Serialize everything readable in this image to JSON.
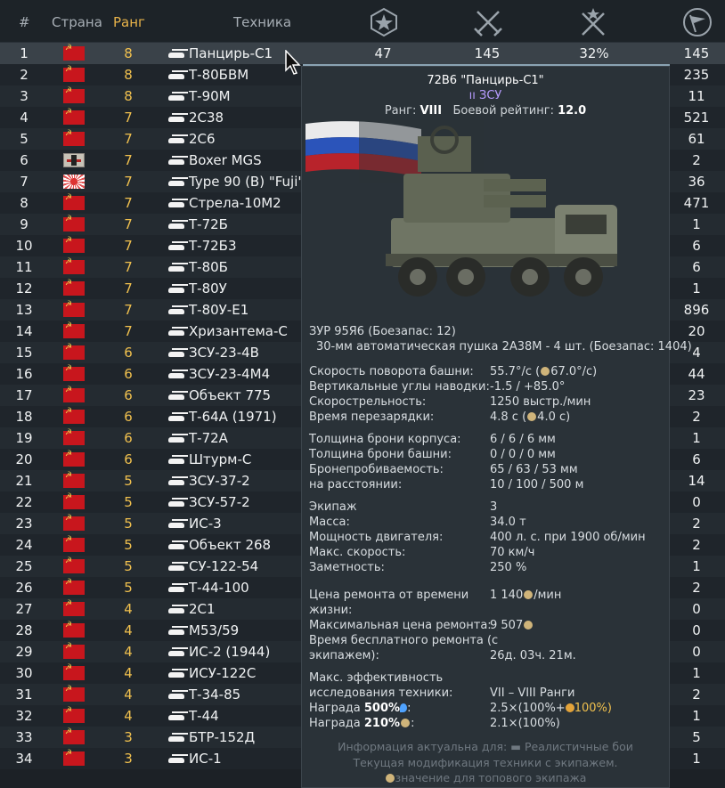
{
  "header": {
    "num": "#",
    "country": "Страна",
    "rank": "Ранг",
    "vehicle": "Техника",
    "icons": [
      "battles-icon",
      "kills-icon",
      "winrate-icon",
      "flag-icon"
    ]
  },
  "rows": [
    {
      "num": "1",
      "flag": "ussr",
      "rank": "8",
      "name": "Панцирь-С1",
      "v1": "47",
      "v2": "145",
      "v3": "32%",
      "v4": "145"
    },
    {
      "num": "2",
      "flag": "ussr",
      "rank": "8",
      "name": "Т-80БВМ",
      "v4": "235"
    },
    {
      "num": "3",
      "flag": "ussr",
      "rank": "8",
      "name": "Т-90М",
      "v4": "11"
    },
    {
      "num": "4",
      "flag": "ussr",
      "rank": "7",
      "name": "2С38",
      "v4": "521"
    },
    {
      "num": "5",
      "flag": "ussr",
      "rank": "7",
      "name": "2С6",
      "v4": "61"
    },
    {
      "num": "6",
      "flag": "de",
      "rank": "7",
      "name": "Boxer MGS",
      "v4": "2"
    },
    {
      "num": "7",
      "flag": "jp",
      "rank": "7",
      "name": "Type 90 (B) \"Fuji\"",
      "v4": "36"
    },
    {
      "num": "8",
      "flag": "ussr",
      "rank": "7",
      "name": "Стрела-10М2",
      "v4": "471"
    },
    {
      "num": "9",
      "flag": "ussr",
      "rank": "7",
      "name": "Т-72Б",
      "v4": "1"
    },
    {
      "num": "10",
      "flag": "ussr",
      "rank": "7",
      "name": "Т-72Б3",
      "v4": "6"
    },
    {
      "num": "11",
      "flag": "ussr",
      "rank": "7",
      "name": "Т-80Б",
      "v4": "6"
    },
    {
      "num": "12",
      "flag": "ussr",
      "rank": "7",
      "name": "Т-80У",
      "v4": "1"
    },
    {
      "num": "13",
      "flag": "ussr",
      "rank": "7",
      "name": "Т-80У-Е1",
      "v4": "896"
    },
    {
      "num": "14",
      "flag": "ussr",
      "rank": "7",
      "name": "Хризантема-С",
      "v4": "20"
    },
    {
      "num": "15",
      "flag": "ussr",
      "rank": "6",
      "name": "ЗСУ-23-4В",
      "v4": "4"
    },
    {
      "num": "16",
      "flag": "ussr",
      "rank": "6",
      "name": "ЗСУ-23-4М4",
      "v4": "44"
    },
    {
      "num": "17",
      "flag": "ussr",
      "rank": "6",
      "name": "Объект 775",
      "v4": "23"
    },
    {
      "num": "18",
      "flag": "ussr",
      "rank": "6",
      "name": "Т-64А (1971)",
      "v4": "2"
    },
    {
      "num": "19",
      "flag": "ussr",
      "rank": "6",
      "name": "Т-72А",
      "v4": "1"
    },
    {
      "num": "20",
      "flag": "ussr",
      "rank": "6",
      "name": "Штурм-С",
      "v4": "6"
    },
    {
      "num": "21",
      "flag": "ussr",
      "rank": "5",
      "name": "ЗСУ-37-2",
      "v4": "14"
    },
    {
      "num": "22",
      "flag": "ussr",
      "rank": "5",
      "name": "ЗСУ-57-2",
      "v4": "0"
    },
    {
      "num": "23",
      "flag": "ussr",
      "rank": "5",
      "name": "ИС-3",
      "v4": "2"
    },
    {
      "num": "24",
      "flag": "ussr",
      "rank": "5",
      "name": "Объект 268",
      "v4": "2"
    },
    {
      "num": "25",
      "flag": "ussr",
      "rank": "5",
      "name": "СУ-122-54",
      "v4": "1"
    },
    {
      "num": "26",
      "flag": "ussr",
      "rank": "5",
      "name": "Т-44-100",
      "v4": "2"
    },
    {
      "num": "27",
      "flag": "ussr",
      "rank": "4",
      "name": "2С1",
      "v4": "0"
    },
    {
      "num": "28",
      "flag": "ussr",
      "rank": "4",
      "name": "M53/59",
      "v4": "0"
    },
    {
      "num": "29",
      "flag": "ussr",
      "rank": "4",
      "name": "ИС-2 (1944)",
      "v4": "0"
    },
    {
      "num": "30",
      "flag": "ussr",
      "rank": "4",
      "name": "ИСУ-122С",
      "v4": "1"
    },
    {
      "num": "31",
      "flag": "ussr",
      "rank": "4",
      "name": "Т-34-85",
      "v4": "2"
    },
    {
      "num": "32",
      "flag": "ussr",
      "rank": "4",
      "name": "Т-44",
      "v4": "1"
    },
    {
      "num": "33",
      "flag": "ussr",
      "rank": "3",
      "name": "БТР-152Д",
      "v4": "5"
    },
    {
      "num": "34",
      "flag": "ussr",
      "rank": "3",
      "name": "ИС-1",
      "v4": "1"
    }
  ],
  "tooltip": {
    "title": "72В6 \"Панцирь-С1\"",
    "class": "ЗСУ",
    "rank_label": "Ранг:",
    "rank_value": "VIII",
    "br_label": "Боевой рейтинг:",
    "br_value": "12.0",
    "weapons": [
      "ЗУР 95Я6 (Боезапас: 12)",
      "30-мм автоматическая пушка 2А38М - 4 шт. (Боезапас: 1404)"
    ],
    "stats": [
      {
        "label": "Скорость поворота башни:",
        "value": "55.7°/с (",
        "extra": "67.0°/с)"
      },
      {
        "label": "Вертикальные углы наводки:",
        "value": "-1.5 / +85.0°"
      },
      {
        "label": "Скорострельность:",
        "value": "1250 выстр./мин"
      },
      {
        "label": "Время перезарядки:",
        "value": "4.8 с (",
        "extra": "4.0 с)"
      },
      {
        "label": "Толщина брони корпуса:",
        "value": "6 / 6 / 6 мм"
      },
      {
        "label": "Толщина брони башни:",
        "value": "0 / 0 / 0 мм"
      },
      {
        "label": "Бронепробиваемость:",
        "value": "65 / 63 / 53 мм"
      },
      {
        "label": "на расстоянии:",
        "value": "10 / 100 / 500 м"
      },
      {
        "label": "Экипаж",
        "value": "3"
      },
      {
        "label": "Масса:",
        "value": "34.0 т"
      },
      {
        "label": "Мощность двигателя:",
        "value": "400 л. с. при 1900 об/мин"
      },
      {
        "label": "Макс. скорость:",
        "value": "70 км/ч"
      },
      {
        "label": "Заметность:",
        "value": "250 %"
      }
    ],
    "repair": {
      "time_cost_label_1": "Цена ремонта от времени",
      "time_cost_label_2": "жизни:",
      "time_cost_value": "1 140",
      "time_cost_unit": "/мин",
      "max_cost_label": "Максимальная цена ремонта:",
      "max_cost_value": "9 507",
      "free_label_1": "Время бесплатного ремонта (с",
      "free_label_2": "экипажем):",
      "free_value": "26д. 03ч. 21м."
    },
    "research": {
      "eff_label_1": "Макс. эффективность",
      "eff_label_2": "исследования техники:",
      "eff_value": "VII – VIII Ранги",
      "reward1_label": "Награда",
      "reward1_pct": "500%",
      "reward1_value": "2.5×(100%+",
      "reward1_extra": "100%)",
      "reward2_label": "Награда",
      "reward2_pct": "210%",
      "reward2_value": "2.1×(100%)"
    },
    "footer": {
      "line1_prefix": "Информация актуальна для:",
      "line1_mode": "Реалистичные бои",
      "line2": "Текущая модификация техники с экипажем.",
      "line3": "значение для топового экипажа"
    }
  },
  "colors": {
    "rank": "#f0c04e",
    "class": "#b79cff",
    "background": "#1c2126"
  }
}
